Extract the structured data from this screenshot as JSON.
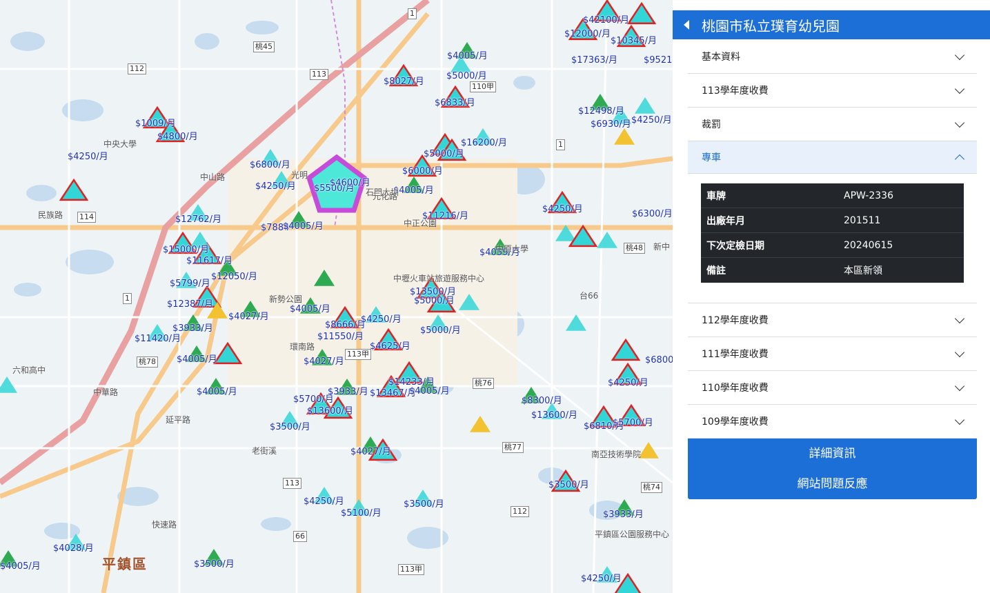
{
  "header": {
    "title": "桃園市私立璞育幼兒園"
  },
  "accordion": {
    "basic": "基本資料",
    "fee113": "113學年度收費",
    "penalty": "裁罰",
    "bus": "專車",
    "fee112": "112學年度收費",
    "fee111": "111學年度收費",
    "fee110": "110學年度收費",
    "fee109": "109學年度收費"
  },
  "vehicle": {
    "rows": [
      {
        "key": "車牌",
        "value": "APW-2336"
      },
      {
        "key": "出廠年月",
        "value": "201511"
      },
      {
        "key": "下次定檢日期",
        "value": "20240615"
      },
      {
        "key": "備註",
        "value": "本區新領"
      }
    ]
  },
  "actions": {
    "detail": "詳細資訊",
    "feedback": "網站問題反應"
  },
  "map": {
    "prices": [
      "$42100/月",
      "$12000/月",
      "$10345/月",
      "$9521",
      "$4005/月",
      "$5000/月",
      "$8027/月",
      "$6833/月",
      "$17363/月",
      "$12498/月",
      "$6930/月",
      "$4250/月",
      "$1009/月",
      "$4800/月",
      "$4250/月",
      "$16200/月",
      "$6800/月",
      "$4250/月",
      "$5500/月",
      "$4600/月",
      "$6000/月",
      "$4005/月",
      "$5000/月",
      "$12762/月",
      "$7884",
      "$4005/月",
      "$11216/月",
      "$4250/月",
      "$6300/月",
      "$4059/月",
      "$15000/月",
      "$11617/月",
      "$12050/月",
      "$5799/月",
      "$12387/月",
      "$4027/月",
      "$3933/月",
      "$11420/月",
      "$4005/月",
      "$8666/月",
      "$11550/月",
      "$4250/月",
      "$13500/月",
      "$5000/月",
      "$4625/月",
      "$4027/月",
      "$4005/月",
      "$5000/月",
      "$4005/月",
      "$14233/月",
      "$13467/月",
      "$4005/月",
      "$5700/月",
      "$3933/月",
      "$13600/月",
      "$3500/月",
      "$4027/月",
      "$8300/月",
      "$13600/月",
      "$6810/月",
      "$5700/月",
      "$4250/月",
      "$3500/月",
      "$4250/月",
      "$5100/月",
      "$3500/月",
      "$4028/月",
      "$3933/月",
      "$3500/月",
      "$4005/月",
      "$4250/月",
      "$6800"
    ],
    "places": [
      "中央大學",
      "光明",
      "中原大學",
      "中正公園",
      "中壢火車站旅遊服務中心",
      "新勢公園",
      "六和高中",
      "南亞技術學院",
      "平鎮區公園服務中心",
      "新中"
    ],
    "districts": [
      "平鎮區"
    ],
    "roads": [
      "民族路",
      "中華路",
      "延平路",
      "環南路",
      "老街溪",
      "快速路",
      "中山路",
      "台66",
      "石門大圳",
      "元化路"
    ],
    "shields": [
      "桃45",
      "112",
      "113",
      "114",
      "110甲",
      "桃48",
      "113甲",
      "桃78",
      "桃76",
      "桃77",
      "桃74",
      "112",
      "113甲",
      "113",
      "1",
      "1",
      "1",
      "66"
    ]
  },
  "colors": {
    "accent": "#1c6fd6",
    "marker_red": "#e02020",
    "marker_green": "#2eaa52",
    "marker_cyan": "#33d6d6",
    "marker_yellow": "#f2c230",
    "selected": "#c64bd8"
  }
}
